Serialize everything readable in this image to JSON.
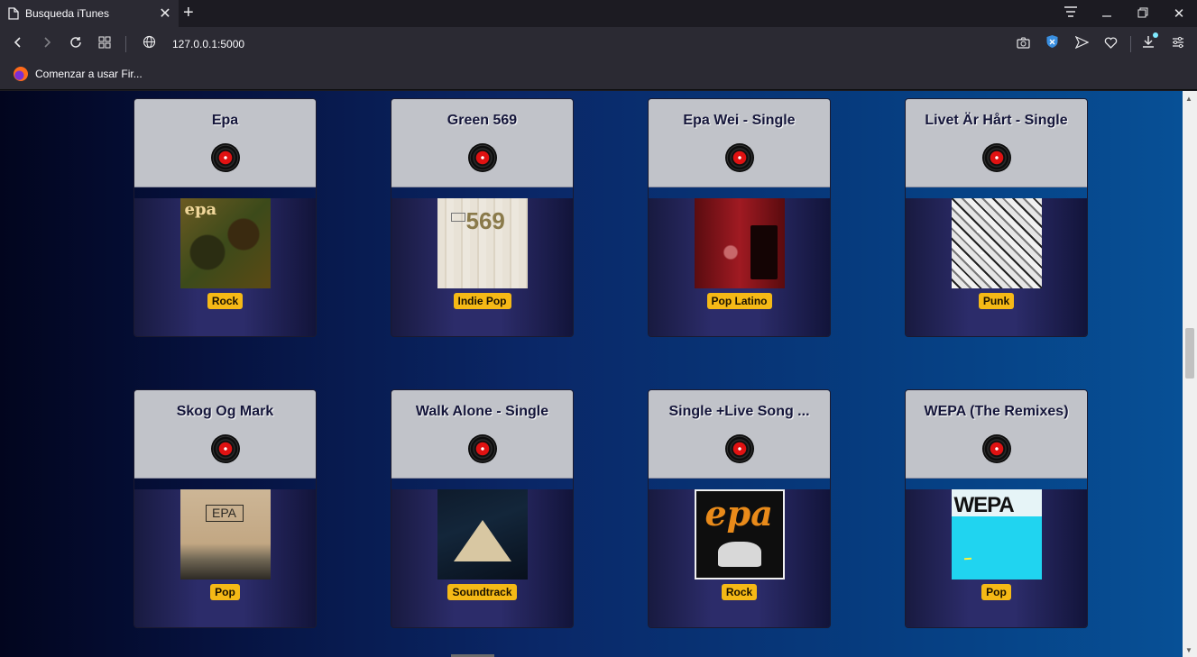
{
  "browser": {
    "tab_title": "Busqueda iTunes",
    "url": "127.0.0.1:5000",
    "bookmark_label": "Comenzar a usar Fir..."
  },
  "albums": [
    {
      "title": "Epa",
      "genre": "Rock",
      "cover": "c-epa",
      "cover_text": "epa"
    },
    {
      "title": "Green 569",
      "genre": "Indie Pop",
      "cover": "c-green",
      "cover_text": "569"
    },
    {
      "title": "Epa Wei - Single",
      "genre": "Pop Latino",
      "cover": "c-wei",
      "cover_text": ""
    },
    {
      "title": "Livet Är Hårt - Single",
      "genre": "Punk",
      "cover": "c-livet",
      "cover_text": ""
    },
    {
      "title": "Skog Og Mark",
      "genre": "Pop",
      "cover": "c-skog",
      "cover_text": "EPA"
    },
    {
      "title": "Walk Alone - Single",
      "genre": "Soundtrack",
      "cover": "c-walk",
      "cover_text": ""
    },
    {
      "title": "Single +Live Song ...",
      "genre": "Rock",
      "cover": "c-single",
      "cover_text": "epa"
    },
    {
      "title": "WEPA (The Remixes)",
      "genre": "Pop",
      "cover": "c-wepa",
      "cover_text": "WEPA"
    }
  ]
}
